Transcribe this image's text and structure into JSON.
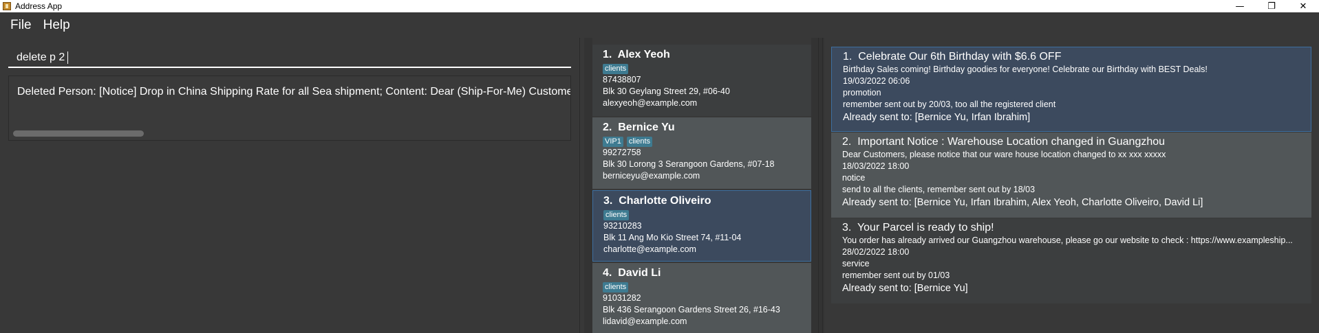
{
  "window": {
    "title": "Address App",
    "minimize": "—",
    "restore": "❐",
    "close": "✕"
  },
  "menu": {
    "file": "File",
    "help": "Help"
  },
  "command": {
    "value": "delete p 2"
  },
  "result": {
    "text": "Deleted Person: [Notice] Drop in China Shipping Rate for all Sea shipment; Content: Dear (Ship-For-Me) Customers"
  },
  "persons": [
    {
      "index": "1.",
      "name": "Alex Yeoh",
      "tags": [
        "clients"
      ],
      "phone": "87438807",
      "address": "Blk 30 Geylang Street 29, #06-40",
      "email": "alexyeoh@example.com"
    },
    {
      "index": "2.",
      "name": "Bernice Yu",
      "tags": [
        "VIP1",
        "clients"
      ],
      "phone": "99272758",
      "address": "Blk 30 Lorong 3 Serangoon Gardens, #07-18",
      "email": "berniceyu@example.com"
    },
    {
      "index": "3.",
      "name": "Charlotte Oliveiro",
      "tags": [
        "clients"
      ],
      "phone": "93210283",
      "address": "Blk 11 Ang Mo Kio Street 74, #11-04",
      "email": "charlotte@example.com"
    },
    {
      "index": "4.",
      "name": "David Li",
      "tags": [
        "clients"
      ],
      "phone": "91031282",
      "address": "Blk 436 Serangoon Gardens Street 26, #16-43",
      "email": "lidavid@example.com"
    }
  ],
  "notices": [
    {
      "index": "1.",
      "title": "Celebrate Our 6th Birthday with $6.6 OFF",
      "content": "Birthday Sales coming! Birthday goodies for everyone! Celebrate our Birthday with BEST Deals!",
      "datetime": "19/03/2022 06:06",
      "type": "promotion",
      "remark": "remember sent out by 20/03, too all the registered client",
      "sent": "Already sent to: [Bernice Yu, Irfan Ibrahim]"
    },
    {
      "index": "2.",
      "title": "Important Notice : Warehouse Location changed in Guangzhou",
      "content": "Dear Customers, please notice that our ware house location changed to xx xxx xxxxx",
      "datetime": "18/03/2022 18:00",
      "type": "notice",
      "remark": "send to all the clients, remember sent out by 18/03",
      "sent": "Already sent to: [Bernice Yu, Irfan Ibrahim, Alex Yeoh, Charlotte Oliveiro, David Li]"
    },
    {
      "index": "3.",
      "title": "Your Parcel is ready to ship!",
      "content": "You order has already arrived our Guangzhou warehouse, please go our website to check : https://www.exampleship...",
      "datetime": "28/02/2022 18:00",
      "type": "service",
      "remark": "remember sent out by 01/03",
      "sent": "Already sent to: [Bernice Yu]"
    }
  ],
  "colors": {
    "background": "#383838",
    "selected": "#3c4a5e",
    "tag": "#3e7b91"
  }
}
